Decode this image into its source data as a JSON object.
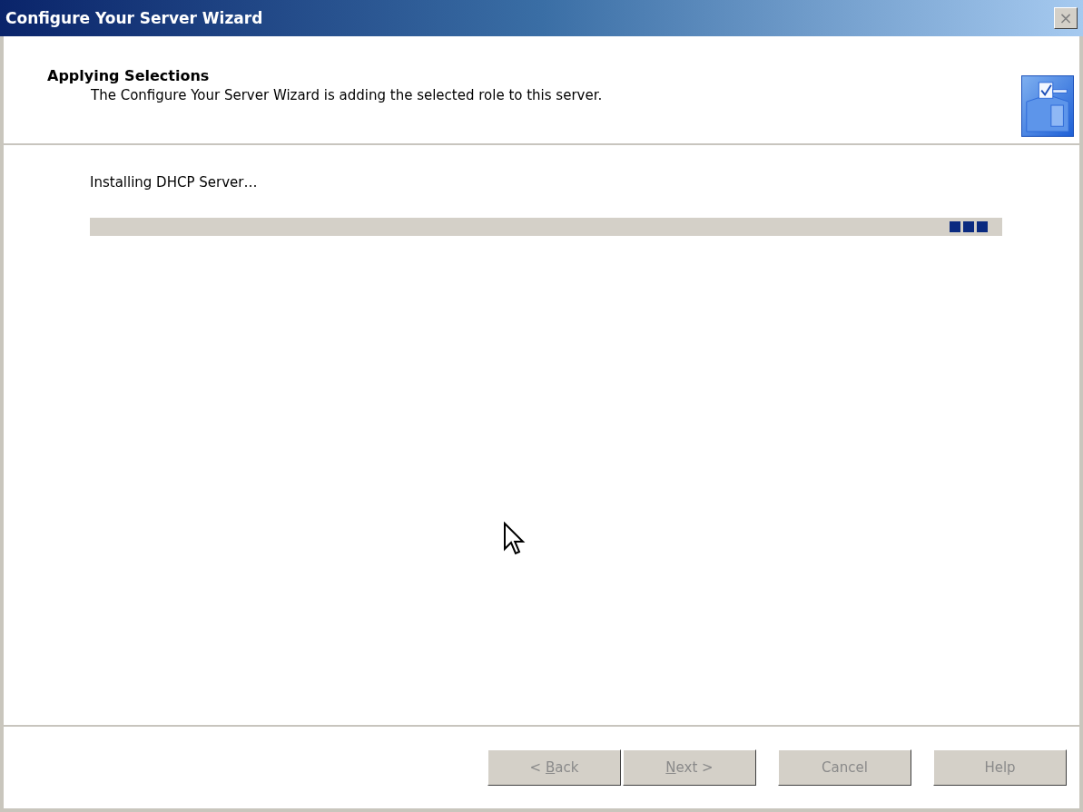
{
  "window": {
    "title": "Configure Your Server Wizard",
    "close": "×"
  },
  "header": {
    "title": "Applying Selections",
    "subtitle": "The Configure Your Server Wizard is adding the selected role to this server."
  },
  "status": "Installing DHCP Server…",
  "progress": {
    "kind": "marquee",
    "level": 0.99
  },
  "buttons": [
    {
      "before": "< ",
      "key": "B",
      "after": "ack",
      "disabled": true
    },
    {
      "key": "N",
      "after": "ext >",
      "disabled": true
    },
    {
      "before": "Cancel",
      "disabled": true
    },
    {
      "before": "Help",
      "disabled": true
    }
  ]
}
